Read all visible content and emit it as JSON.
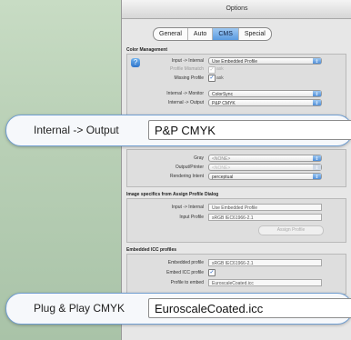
{
  "window": {
    "title": "Options"
  },
  "tabs": [
    {
      "label": "General",
      "active": false
    },
    {
      "label": "Auto",
      "active": false
    },
    {
      "label": "CMS",
      "active": true
    },
    {
      "label": "Special",
      "active": false
    }
  ],
  "color_management": {
    "title": "Color Management",
    "input_internal_label": "Input -> Internal",
    "input_internal_value": "Use Embedded Profile",
    "profile_mismatch_label": "Profile Mismatch",
    "profile_mismatch_check": "ask",
    "missing_profile_label": "Missing Profile",
    "missing_profile_check": "ask",
    "internal_monitor_label": "Internal -> Monitor",
    "internal_monitor_value": "ColorSync",
    "internal_output_label": "Internal -> Output",
    "internal_output_value": "P&P CMYK",
    "gray_label": "Gray",
    "gray_value": "<NONE>",
    "output_printer_label": "Output/Printer",
    "output_printer_value": "<NONE>",
    "rendering_intent_label": "Rendering Intent",
    "rendering_intent_value": "perceptual"
  },
  "assign_profile": {
    "title": "Image specifics from Assign Profile Dialog",
    "input_internal_label": "Input -> Internal",
    "input_internal_value": "Use Embedded Profile",
    "input_profile_label": "Input Profile",
    "input_profile_value": "sRGB IEC61966-2.1",
    "button_label": "Assign Profile"
  },
  "embedded": {
    "title": "Embedded ICC profiles",
    "embedded_profile_label": "Embedded profile",
    "embedded_profile_value": "sRGB IEC61966-2.1",
    "embed_icc_label": "Embed ICC profile",
    "profile_to_embed_label": "Profile to embed",
    "profile_to_embed_value": "EuroscaleCoated.icc"
  },
  "callouts": {
    "output": {
      "label": "Internal -> Output",
      "value": "P&P CMYK"
    },
    "plug": {
      "label": "Plug & Play CMYK",
      "value": "EuroscaleCoated.icc"
    }
  },
  "icons": {
    "help": "question-mark-icon",
    "popup_arrow": "up-down-arrows-icon",
    "check": "checkmark-icon"
  }
}
